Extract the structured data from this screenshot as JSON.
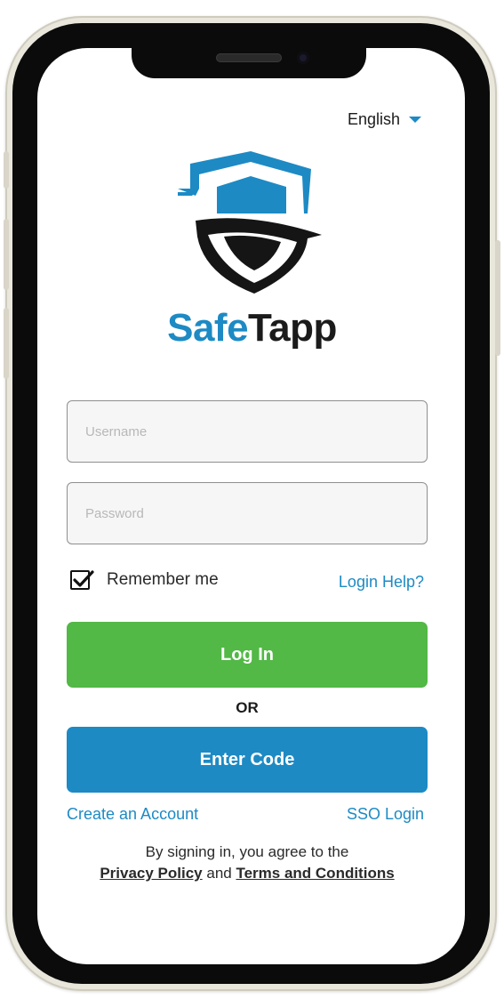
{
  "header": {
    "language": "English"
  },
  "brand": {
    "part1": "Safe",
    "part2": "Tapp",
    "primary_color": "#1d8ac4",
    "dark_color": "#1b1b1b"
  },
  "form": {
    "username_placeholder": "Username",
    "username_value": "",
    "password_placeholder": "Password",
    "password_value": "",
    "remember_label": "Remember me",
    "remember_checked": true,
    "help_link": "Login Help?"
  },
  "actions": {
    "login_label": "Log In",
    "login_color": "#52b846",
    "or_label": "OR",
    "code_label": "Enter Code",
    "code_color": "#1d8ac4"
  },
  "links": {
    "create_account": "Create an Account",
    "sso_login": "SSO Login"
  },
  "legal": {
    "prefix": "By signing in, you agree to the",
    "privacy": "Privacy Policy",
    "and": "and",
    "terms": "Terms and Conditions"
  }
}
